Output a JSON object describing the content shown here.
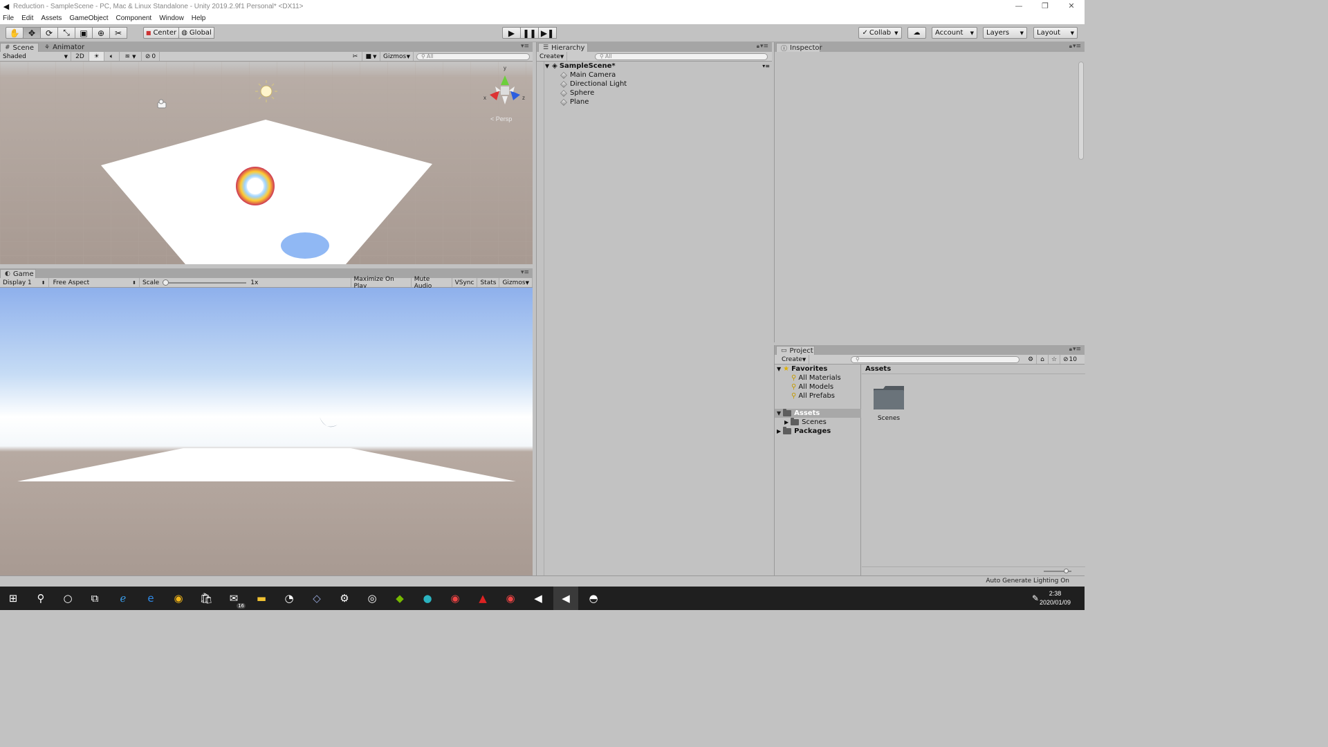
{
  "window": {
    "title": "Reduction - SampleScene - PC, Mac & Linux Standalone - Unity 2019.2.9f1 Personal* <DX11>",
    "controls": [
      "minimize",
      "restore",
      "close"
    ]
  },
  "menu": [
    "File",
    "Edit",
    "Assets",
    "GameObject",
    "Component",
    "Window",
    "Help"
  ],
  "toolbar": {
    "pivot_label": "Center",
    "space_label": "Global",
    "collab_label": "Collab",
    "account_label": "Account",
    "layers_label": "Layers",
    "layout_label": "Layout"
  },
  "scene_panel": {
    "tabs": [
      "Scene",
      "Animator"
    ],
    "shading_mode": "Shaded",
    "mode_2d": "2D",
    "hidden_count": "0",
    "gizmos_label": "Gizmos",
    "search_placeholder": "All",
    "persp_label": "< Persp",
    "axes": {
      "x": "x",
      "y": "y",
      "z": "z"
    }
  },
  "game_panel": {
    "tab": "Game",
    "display": "Display 1",
    "aspect": "Free Aspect",
    "scale_label": "Scale",
    "scale_value": "1x",
    "scale_fraction": 0.0,
    "buttons": [
      "Maximize On Play",
      "Mute Audio",
      "VSync",
      "Stats",
      "Gizmos"
    ]
  },
  "hierarchy": {
    "tab": "Hierarchy",
    "create_label": "Create",
    "search_placeholder": "All",
    "scene_name": "SampleScene*",
    "items": [
      "Main Camera",
      "Directional Light",
      "Sphere",
      "Plane"
    ]
  },
  "inspector": {
    "tab": "Inspector"
  },
  "project": {
    "tab": "Project",
    "create_label": "Create",
    "hidden_count": "10",
    "favorites_label": "Favorites",
    "favorites": [
      "All Materials",
      "All Models",
      "All Prefabs"
    ],
    "assets_label": "Assets",
    "assets_children": [
      "Scenes"
    ],
    "packages_label": "Packages",
    "breadcrumb": "Assets",
    "grid_items": [
      "Scenes"
    ]
  },
  "status": {
    "right_text": "Auto Generate Lighting On"
  },
  "taskbar": {
    "mail_badge": "16",
    "time": "2:38",
    "date": "2020/01/09"
  },
  "colors": {
    "editor_bg": "#c2c2c2",
    "tab_strip": "#a5a5a5",
    "selection": "#a8a8a8",
    "taskbar": "#1f1f1f",
    "sky_top": "#8fb2ee",
    "ground": "#a89a92"
  }
}
